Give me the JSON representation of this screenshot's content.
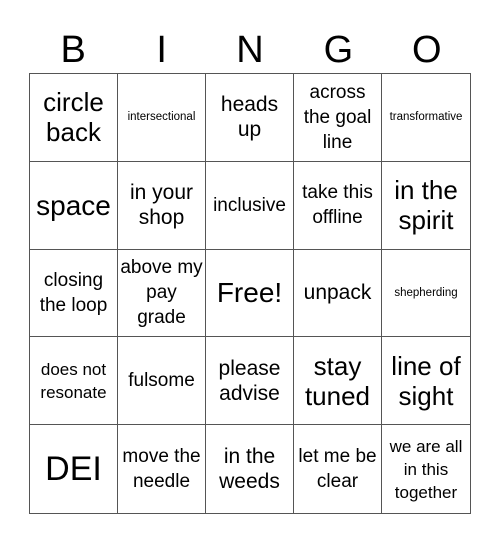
{
  "header": [
    "B",
    "I",
    "N",
    "G",
    "O"
  ],
  "cells": [
    {
      "text": "circle back",
      "size": "s-ml"
    },
    {
      "text": "intersectional",
      "size": "s-xs"
    },
    {
      "text": "heads up",
      "size": "s-m"
    },
    {
      "text": "across the goal line",
      "size": "s-r"
    },
    {
      "text": "transformative",
      "size": "s-xs"
    },
    {
      "text": "space",
      "size": "s-l"
    },
    {
      "text": "in your shop",
      "size": "s-m"
    },
    {
      "text": "inclusive",
      "size": "s-r"
    },
    {
      "text": "take this offline",
      "size": "s-r"
    },
    {
      "text": "in the spirit",
      "size": "s-ml"
    },
    {
      "text": "closing the loop",
      "size": "s-r"
    },
    {
      "text": "above my pay grade",
      "size": "s-r"
    },
    {
      "text": "Free!",
      "size": "s-l"
    },
    {
      "text": "unpack",
      "size": "s-m"
    },
    {
      "text": "shepherding",
      "size": "s-xs"
    },
    {
      "text": "does not resonate",
      "size": "s-s"
    },
    {
      "text": "fulsome",
      "size": "s-r"
    },
    {
      "text": "please advise",
      "size": "s-m"
    },
    {
      "text": "stay tuned",
      "size": "s-ml"
    },
    {
      "text": "line of sight",
      "size": "s-ml"
    },
    {
      "text": "DEI",
      "size": "s-xl"
    },
    {
      "text": "move the needle",
      "size": "s-r"
    },
    {
      "text": "in the weeds",
      "size": "s-m"
    },
    {
      "text": "let me be clear",
      "size": "s-r"
    },
    {
      "text": "we are all in this together",
      "size": "s-s"
    }
  ]
}
